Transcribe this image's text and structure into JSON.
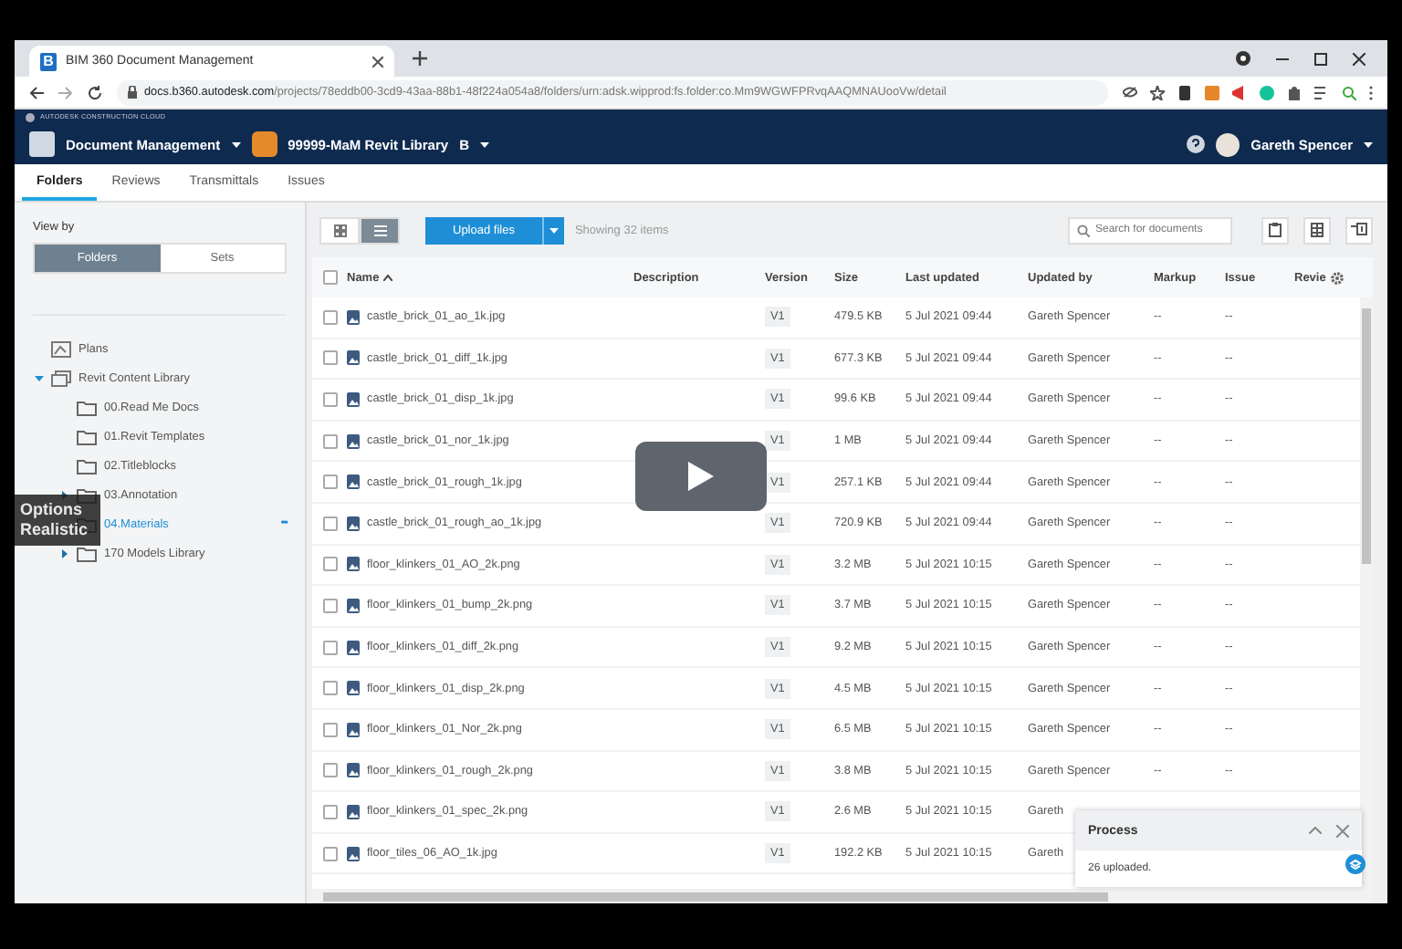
{
  "browser": {
    "tab_title": "BIM 360 Document Management",
    "favicon": "B",
    "url_domain": "docs.b360.autodesk.com",
    "url_path": "/projects/78eddb00-3cd9-43aa-88b1-48f224a054a8/folders/urn:adsk.wipprod:fs.folder:co.Mm9WGWFPRvqAAQMNAUooVw/detail"
  },
  "brand": "AUTODESK CONSTRUCTION CLOUD",
  "header": {
    "module": "Document Management",
    "project": "99999-MaM Revit Library",
    "project_badge": "B",
    "user": "Gareth Spencer"
  },
  "tabs": [
    {
      "label": "Folders",
      "selected": true
    },
    {
      "label": "Reviews",
      "selected": false
    },
    {
      "label": "Transmittals",
      "selected": false
    },
    {
      "label": "Issues",
      "selected": false
    }
  ],
  "sidebar": {
    "view_by": "View by",
    "toggle": [
      {
        "label": "Folders",
        "selected": true
      },
      {
        "label": "Sets",
        "selected": false
      }
    ],
    "tree": [
      {
        "label": "Plans",
        "kind": "plans",
        "selected": false
      },
      {
        "label": "Revit Content Library",
        "kind": "project",
        "selected": false,
        "expanded": true,
        "children": [
          {
            "label": "00.Read Me Docs",
            "kind": "folder",
            "selected": false
          },
          {
            "label": "01.Revit Templates",
            "kind": "folder",
            "selected": false
          },
          {
            "label": "02.Titleblocks",
            "kind": "folder",
            "selected": false
          },
          {
            "label": "03.Annotation",
            "kind": "folder",
            "selected": false,
            "expanded": false
          },
          {
            "label": "04.Materials",
            "kind": "folder",
            "selected": true,
            "more": "•••"
          },
          {
            "label": "170 Models Library",
            "kind": "folder",
            "selected": false,
            "expanded": false
          }
        ]
      }
    ]
  },
  "toolbar": {
    "view_modes": [
      {
        "kind": "grid",
        "selected": false
      },
      {
        "kind": "list",
        "selected": true
      }
    ],
    "upload": "Upload files",
    "count": "Showing 32 items",
    "search": {
      "placeholder": "Search for documents"
    }
  },
  "table": {
    "select_all_checked": false,
    "columns": [
      "Name",
      "Description",
      "Version",
      "Size",
      "Last updated",
      "Updated by",
      "Markup",
      "Issue",
      "Revie"
    ],
    "rows": [
      {
        "name": "castle_brick_01_ao_1k.jpg",
        "version": "V1",
        "size": "479.5 KB",
        "updated": "5 Jul 2021 09:44",
        "by": "Gareth Spencer",
        "markup": "--",
        "issue": "--",
        "checked": false
      },
      {
        "name": "castle_brick_01_diff_1k.jpg",
        "version": "V1",
        "size": "677.3 KB",
        "updated": "5 Jul 2021 09:44",
        "by": "Gareth Spencer",
        "markup": "--",
        "issue": "--",
        "checked": false
      },
      {
        "name": "castle_brick_01_disp_1k.jpg",
        "version": "V1",
        "size": "99.6 KB",
        "updated": "5 Jul 2021 09:44",
        "by": "Gareth Spencer",
        "markup": "--",
        "issue": "--",
        "checked": false
      },
      {
        "name": "castle_brick_01_nor_1k.jpg",
        "version": "V1",
        "size": "1 MB",
        "updated": "5 Jul 2021 09:44",
        "by": "Gareth Spencer",
        "markup": "--",
        "issue": "--",
        "checked": false
      },
      {
        "name": "castle_brick_01_rough_1k.jpg",
        "version": "V1",
        "size": "257.1 KB",
        "updated": "5 Jul 2021 09:44",
        "by": "Gareth Spencer",
        "markup": "--",
        "issue": "--",
        "checked": false
      },
      {
        "name": "castle_brick_01_rough_ao_1k.jpg",
        "version": "V1",
        "size": "720.9 KB",
        "updated": "5 Jul 2021 09:44",
        "by": "Gareth Spencer",
        "markup": "--",
        "issue": "--",
        "checked": false
      },
      {
        "name": "floor_klinkers_01_AO_2k.png",
        "version": "V1",
        "size": "3.2 MB",
        "updated": "5 Jul 2021 10:15",
        "by": "Gareth Spencer",
        "markup": "--",
        "issue": "--",
        "checked": false
      },
      {
        "name": "floor_klinkers_01_bump_2k.png",
        "version": "V1",
        "size": "3.7 MB",
        "updated": "5 Jul 2021 10:15",
        "by": "Gareth Spencer",
        "markup": "--",
        "issue": "--",
        "checked": false
      },
      {
        "name": "floor_klinkers_01_diff_2k.png",
        "version": "V1",
        "size": "9.2 MB",
        "updated": "5 Jul 2021 10:15",
        "by": "Gareth Spencer",
        "markup": "--",
        "issue": "--",
        "checked": false
      },
      {
        "name": "floor_klinkers_01_disp_2k.png",
        "version": "V1",
        "size": "4.5 MB",
        "updated": "5 Jul 2021 10:15",
        "by": "Gareth Spencer",
        "markup": "--",
        "issue": "--",
        "checked": false
      },
      {
        "name": "floor_klinkers_01_Nor_2k.png",
        "version": "V1",
        "size": "6.5 MB",
        "updated": "5 Jul 2021 10:15",
        "by": "Gareth Spencer",
        "markup": "--",
        "issue": "--",
        "checked": false
      },
      {
        "name": "floor_klinkers_01_rough_2k.png",
        "version": "V1",
        "size": "3.8 MB",
        "updated": "5 Jul 2021 10:15",
        "by": "Gareth Spencer",
        "markup": "--",
        "issue": "--",
        "checked": false
      },
      {
        "name": "floor_klinkers_01_spec_2k.png",
        "version": "V1",
        "size": "2.6 MB",
        "updated": "5 Jul 2021 10:15",
        "by": "Gareth",
        "checked": false
      },
      {
        "name": "floor_tiles_06_AO_1k.jpg",
        "version": "V1",
        "size": "192.2 KB",
        "updated": "5 Jul 2021 10:15",
        "by": "Gareth",
        "checked": false
      }
    ]
  },
  "process": {
    "title": "Process",
    "message": "26 uploaded."
  },
  "overlay": {
    "lines": [
      "Options",
      "Realistic"
    ]
  }
}
